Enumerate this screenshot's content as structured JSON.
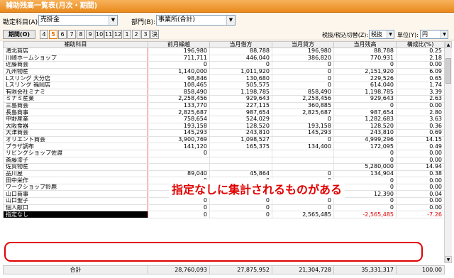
{
  "window": {
    "title": "補助残高一覧表(月次・期間)"
  },
  "filters": {
    "subject_label": "勘定科目(A):",
    "subject_value": "売掛金",
    "dept_label": "部門(B):",
    "dept_value": "事業所(合計)"
  },
  "period": {
    "main_label": "期間(O)",
    "buttons": [
      "4",
      "5",
      "6",
      "7",
      "8",
      "9",
      "10",
      "11",
      "12",
      "1",
      "2",
      "3",
      "決"
    ],
    "active": "5",
    "tax_label": "税抜/税込切替(Z):",
    "tax_value": "税抜",
    "unit_label": "単位(Y):",
    "unit_value": "円"
  },
  "table": {
    "headers": [
      "補助科目",
      "前月繰越",
      "当月借方",
      "当月貸方",
      "当月残高",
      "構成比(%)"
    ],
    "rows": [
      [
        "滝北商店",
        "196,980",
        "88,788",
        "196,980",
        "88,788",
        "0.25"
      ],
      [
        "川崎ホームショップ",
        "711,711",
        "446,040",
        "386,820",
        "770,931",
        "2.18"
      ],
      [
        "近藤商会",
        "0",
        "0",
        "0",
        "0",
        "0.00"
      ],
      [
        "九州物産",
        "1,140,000",
        "1,011,920",
        "0",
        "2,151,920",
        "6.09"
      ],
      [
        "Lスリング 大分店",
        "98,846",
        "130,680",
        "0",
        "229,526",
        "0.65"
      ],
      [
        "Lスリング 福岡店",
        "108,465",
        "505,575",
        "0",
        "614,040",
        "1.74"
      ],
      [
        "有限会社ミナミ",
        "858,490",
        "1,198,785",
        "858,490",
        "1,198,785",
        "3.39"
      ],
      [
        "ミナミ産業",
        "2,258,456",
        "929,643",
        "2,258,456",
        "929,643",
        "2.63"
      ],
      [
        "三島商会",
        "133,770",
        "227,115",
        "360,885",
        "0",
        "0.00"
      ],
      [
        "長島商事",
        "2,825,687",
        "987,654",
        "2,825,687",
        "987,654",
        "2.80"
      ],
      [
        "中野産業",
        "758,654",
        "524,029",
        "0",
        "1,282,683",
        "3.63"
      ],
      [
        "大阪食器",
        "193,158",
        "128,520",
        "193,158",
        "128,520",
        "0.36"
      ],
      [
        "大津商会",
        "145,293",
        "243,810",
        "145,293",
        "243,810",
        "0.69"
      ],
      [
        "オリエント商会",
        "3,900,769",
        "1,098,527",
        "0",
        "4,999,296",
        "14.15"
      ],
      [
        "プラザ調布",
        "141,120",
        "165,375",
        "134,400",
        "172,095",
        "0.49"
      ],
      [
        "リビングショップ佐渡",
        "0",
        "",
        "",
        "0",
        "0.00"
      ],
      [
        "斎藤漆子",
        "",
        "",
        "",
        "0",
        "0.00"
      ],
      [
        "佐賀物産",
        "",
        "",
        "",
        "5,280,000",
        "14.94"
      ],
      [
        "品川屋",
        "89,040",
        "45,864",
        "0",
        "134,904",
        "0.38"
      ],
      [
        "田中栄作",
        "0",
        "0",
        "0",
        "0",
        "0.00"
      ],
      [
        "ワークショップ鈴鹿",
        "0",
        "0",
        "0",
        "0",
        "0.00"
      ],
      [
        "山口商事",
        "12,600",
        "12,390",
        "12,600",
        "12,390",
        "0.04"
      ],
      [
        "山口聖子",
        "0",
        "0",
        "0",
        "0",
        "0.00"
      ],
      [
        "個人献口",
        "0",
        "0",
        "0",
        "0",
        "0.00"
      ],
      [
        "指定なし",
        "0",
        "0",
        "2,565,485",
        "-2,565,485",
        "-7.26"
      ]
    ]
  },
  "totals": {
    "label": "合計",
    "values": [
      "28,760,093",
      "27,875,952",
      "21,304,728",
      "35,331,317",
      "100.00"
    ]
  },
  "annotation": {
    "text": "指定なしに集計されるものがある",
    "color": "#e00000"
  },
  "colors": {
    "title_bar": "#e98a1c",
    "negative": "#e00000",
    "active_period": "#e07000"
  }
}
